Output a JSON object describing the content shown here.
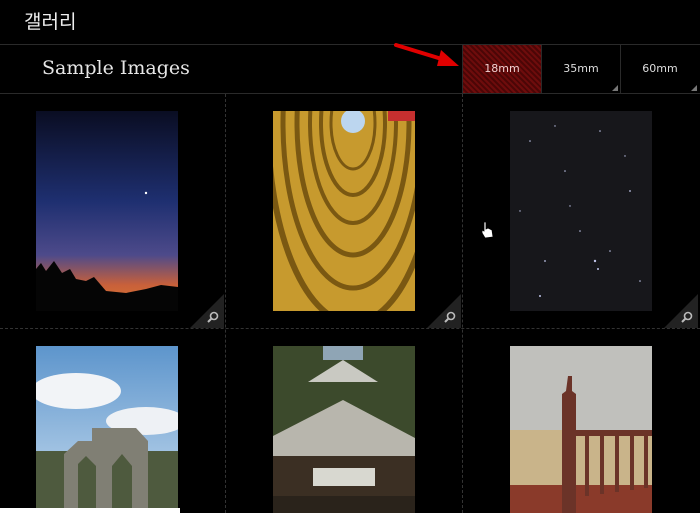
{
  "window": {
    "title": "갤러리"
  },
  "section": {
    "title": "Sample Images"
  },
  "tabs": [
    {
      "label": "18mm",
      "active": true
    },
    {
      "label": "35mm",
      "active": false
    },
    {
      "label": "60mm",
      "active": false
    }
  ],
  "colors": {
    "accent": "#6e0c0c",
    "arrow": "#e00000"
  },
  "icons": {
    "zoom": "magnifier-icon",
    "cursor": "hand-pointer-icon",
    "arrow": "red-arrow-annotation"
  },
  "photos": [
    {
      "name": "photo-twilight"
    },
    {
      "name": "photo-spiral-parking"
    },
    {
      "name": "photo-star-sky"
    },
    {
      "name": "photo-stone-ruin"
    },
    {
      "name": "photo-overgrown-house"
    },
    {
      "name": "photo-staircase-newel"
    }
  ]
}
